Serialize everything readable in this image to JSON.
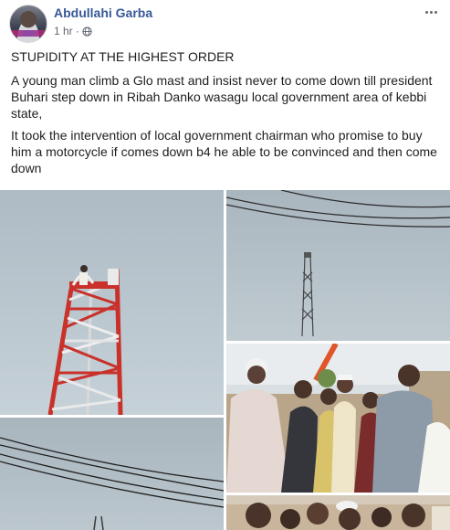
{
  "post": {
    "author": "Abdullahi Garba",
    "time": "1 hr",
    "separator": "·",
    "privacy_icon": "globe-icon",
    "more_icon": "more-options-icon",
    "paragraphs": [
      "STUPIDITY AT THE HIGHEST ORDER",
      "A young man climb a Glo mast and insist never to come down till president Buhari step down in Ribah Danko wasagu local government area of kebbi state,",
      "It took the intervention of local government chairman who promise to buy him a motorcycle if comes down b4 he able to be convinced and then come down"
    ]
  },
  "photos": [
    {
      "subject": "man-on-top-of-red-white-tower"
    },
    {
      "subject": "distant-mast-under-power-lines"
    },
    {
      "subject": "power-lines-and-sky"
    },
    {
      "subject": "crowd-of-men-in-village"
    },
    {
      "subject": "crowd-closeup"
    }
  ],
  "colors": {
    "author_link": "#385898",
    "meta_text": "#616770",
    "body_text": "#1c1e21",
    "tower_red": "#c9312a",
    "sky": "#b9c6cf"
  }
}
